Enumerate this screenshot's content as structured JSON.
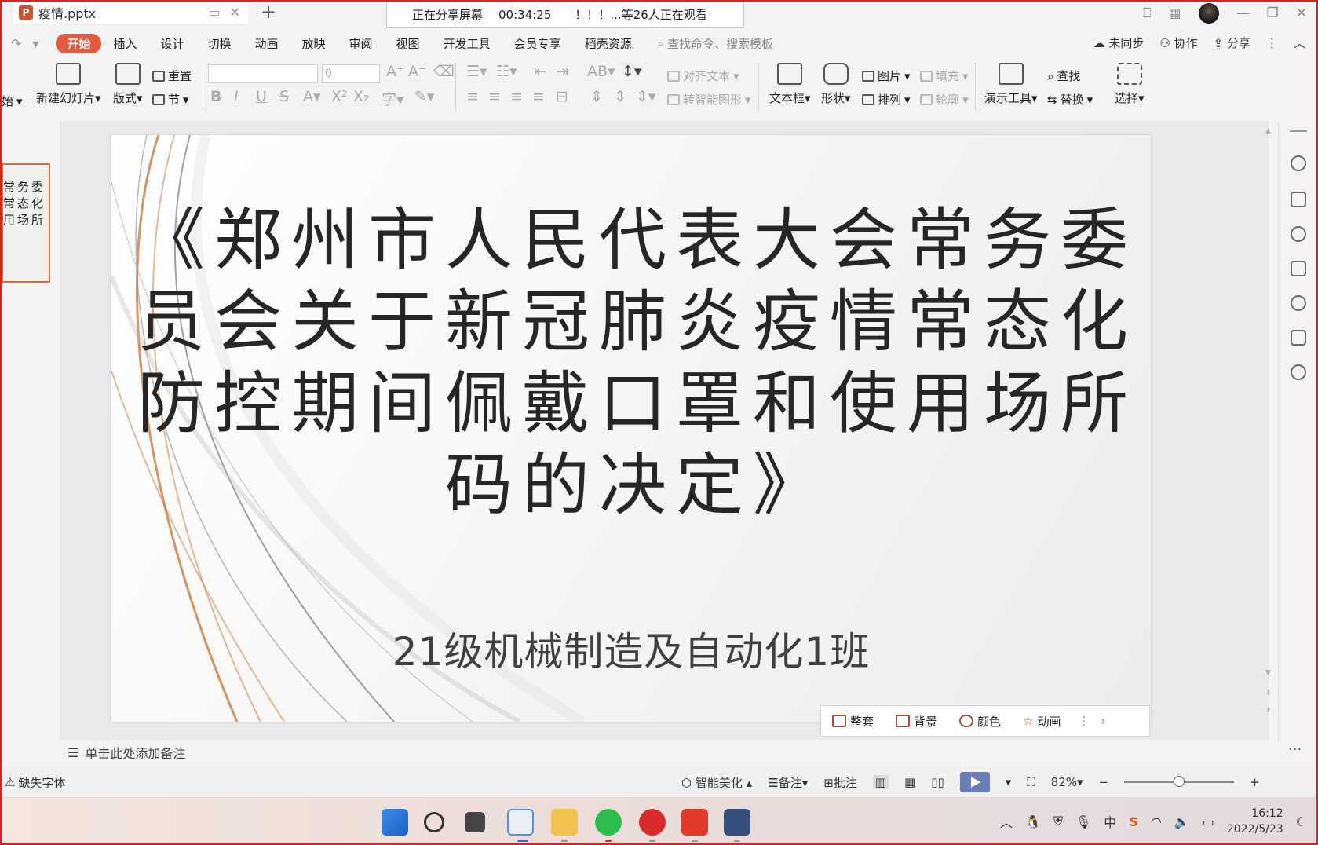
{
  "titlebar": {
    "doc_name": "疫情.pptx",
    "share_status": "正在分享屏幕",
    "share_timer": "00:34:25",
    "share_viewers": "！！！...等26人正在观看"
  },
  "menu": {
    "items": [
      "开始",
      "插入",
      "设计",
      "切换",
      "动画",
      "放映",
      "审阅",
      "视图",
      "开发工具",
      "会员专享",
      "稻壳资源"
    ],
    "active_index": 0,
    "search_placeholder": "查找命令、搜索模板",
    "sync": "未同步",
    "collab": "协作",
    "share": "分享"
  },
  "ribbon": {
    "start_partial": "始",
    "new_slide": "新建幻灯片",
    "layout": "版式",
    "reset": "重置",
    "section": "节",
    "font_size": "0",
    "align_text": "对齐文本",
    "smart_shape": "转智能图形",
    "text_box": "文本框",
    "shape": "形状",
    "picture": "图片",
    "arrange": "排列",
    "fill": "填充",
    "outline": "轮廓",
    "present_tools": "演示工具",
    "find": "查找",
    "replace": "替换",
    "select": "选择"
  },
  "thumbnail": {
    "lines": [
      "常务委",
      "常态化",
      "用场所"
    ]
  },
  "slide": {
    "title_lines": [
      "《郑州市人民代表大会常务委",
      "员会关于新冠肺炎疫情常态化",
      "防控期间佩戴口罩和使用场所",
      "码的决定》"
    ],
    "subtitle": "21级机械制造及自动化1班"
  },
  "float_toolbar": {
    "items": [
      "整套",
      "背景",
      "颜色",
      "动画"
    ]
  },
  "notes": {
    "placeholder": "单击此处添加备注"
  },
  "statusbar": {
    "missing_font": "缺失字体",
    "beautify": "智能美化",
    "notes": "备注",
    "comments": "批注",
    "zoom": "82%",
    "zoom_fraction": 0.5
  },
  "tray": {
    "ime": "中",
    "time": "16:12",
    "date": "2022/5/23"
  },
  "colors": {
    "accent": "#e55a3c",
    "border": "#e01f1f",
    "thumb_border": "#d4703c",
    "play": "#6a7fb8"
  }
}
